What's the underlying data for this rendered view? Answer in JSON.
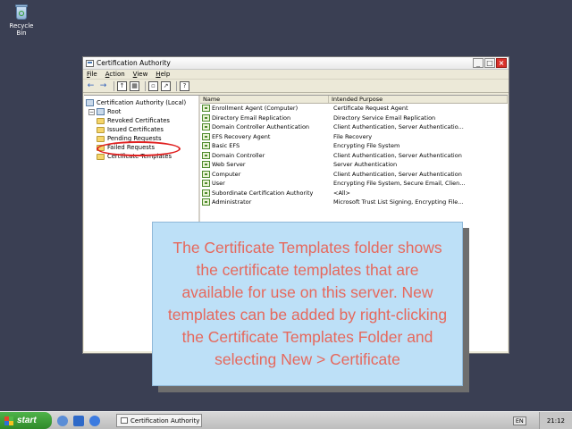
{
  "desktop": {
    "recycle_bin_label": "Recycle Bin"
  },
  "window": {
    "title": "Certification Authority",
    "buttons": {
      "minimize": "_",
      "maximize": "□",
      "close": "×"
    }
  },
  "menu": [
    "File",
    "Action",
    "View",
    "Help"
  ],
  "tree": {
    "root_label": "Certification Authority (Local)",
    "ca_label": "Root",
    "children": [
      "Revoked Certificates",
      "Issued Certificates",
      "Pending Requests",
      "Failed Requests",
      "Certificate Templates"
    ]
  },
  "list": {
    "columns": [
      "Name",
      "Intended Purpose"
    ],
    "rows": [
      {
        "name": "Enrollment Agent (Computer)",
        "purpose": "Certificate Request Agent"
      },
      {
        "name": "Directory Email Replication",
        "purpose": "Directory Service Email Replication"
      },
      {
        "name": "Domain Controller Authentication",
        "purpose": "Client Authentication, Server Authenticatio..."
      },
      {
        "name": "EFS Recovery Agent",
        "purpose": "File Recovery"
      },
      {
        "name": "Basic EFS",
        "purpose": "Encrypting File System"
      },
      {
        "name": "Domain Controller",
        "purpose": "Client Authentication, Server Authentication"
      },
      {
        "name": "Web Server",
        "purpose": "Server Authentication"
      },
      {
        "name": "Computer",
        "purpose": "Client Authentication, Server Authentication"
      },
      {
        "name": "User",
        "purpose": "Encrypting File System, Secure Email, Clien..."
      },
      {
        "name": "Subordinate Certification Authority",
        "purpose": "<All>"
      },
      {
        "name": "Administrator",
        "purpose": "Microsoft Trust List Signing, Encrypting File..."
      }
    ]
  },
  "callout": {
    "text": "The Certificate Templates folder shows the certificate templates that are available for use on this server. New templates can be added by right-clicking the Certificate Templates Folder and selecting New > Certificate",
    "bg_color": "#bde0f7",
    "text_color": "#e6685c"
  },
  "taskbar": {
    "start_label": "start",
    "task_label": "Certification Authority",
    "language": "EN",
    "clock": "21:12"
  },
  "icons": [
    "recycle-bin-icon",
    "back-arrow-icon",
    "forward-arrow-icon",
    "up-folder-icon",
    "console-tree-icon",
    "properties-icon",
    "export-icon",
    "help-icon"
  ]
}
